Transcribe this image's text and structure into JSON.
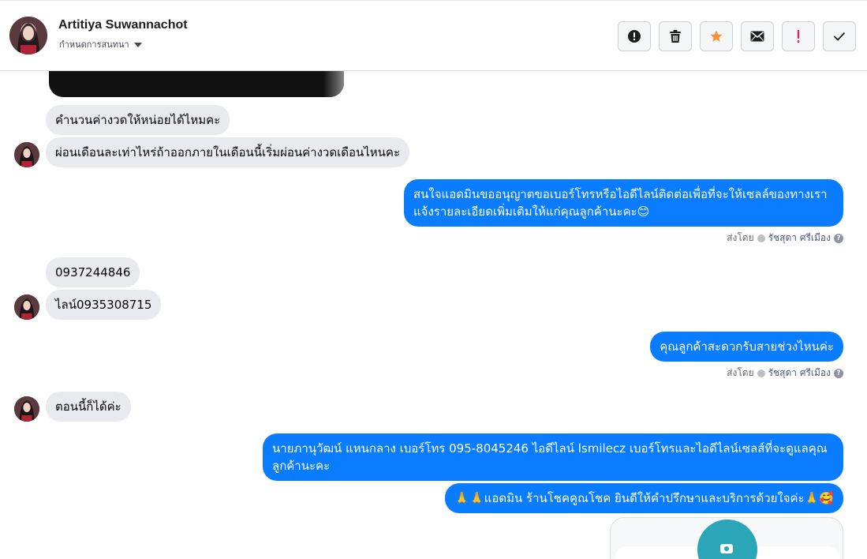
{
  "header": {
    "contact_name": "Artitiya Suwannachot",
    "assign_label": "กำหนดการสนทนา",
    "actions": [
      {
        "icon": "alert-circle-icon",
        "label": "Spam"
      },
      {
        "icon": "trash-icon",
        "label": "Delete"
      },
      {
        "icon": "star-icon",
        "label": "Star"
      },
      {
        "icon": "envelope-icon",
        "label": "Mark unread"
      },
      {
        "icon": "exclamation-icon",
        "label": "Follow up"
      },
      {
        "icon": "check-icon",
        "label": "Done"
      }
    ]
  },
  "messages": {
    "in1": "คำนวนค่างวดให้หน่อยได้ไหมคะ",
    "in2": "ผ่อนเดือนละเท่าไหร่ถ้าออกภายในเดือนนี้เริ่มผ่อนค่างวดเดือนไหนคะ",
    "out1": "สนใจแอดมินขออนุญาตขอเบอร์โทรหรือไอดีไลน์ติดต่อเพื่อที่จะให้เซลล์ของทางเรา แจ้งรายละเอียดเพิ่มเติมให้แก่คุณลูกค้านะคะ😊",
    "in3": "0937244846",
    "in4": "ไลน์0935308715",
    "out2": "คุณลูกค้าสะดวกรับสายช่วงไหนค่ะ",
    "in5": "ตอนนี้ก็ได้ค่ะ",
    "out3": "นายภานุวัฒน์ แหนกลาง เบอร์โทร 095-8045246 ไอดีไลน์ lsmilecz   เบอร์โทรและไอดีไลน์เซลส์ที่จะดูแลคุณลูกค้านะคะ",
    "out4": "🙏🙏แอดมิน ร้านโชคคูณโชค ยินดีให้คำปรึกษาและบริการด้วยใจค่ะ🙏🥰"
  },
  "sent_by": {
    "prefix": "ส่งโดย",
    "agent": "รัชสุดา ศรีเมือง",
    "help": "?"
  },
  "colors": {
    "outgoing": "#0a7cff",
    "incoming": "#e9eaed",
    "star": "#f7923a",
    "exclamation": "#e0245e"
  }
}
